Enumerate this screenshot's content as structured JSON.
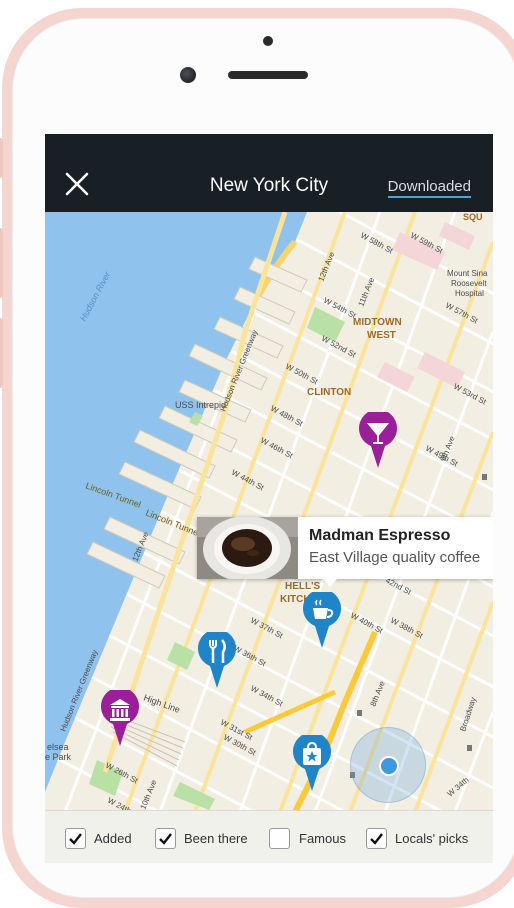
{
  "header": {
    "title": "New York City",
    "downloaded_label": "Downloaded"
  },
  "map": {
    "labels": {
      "hudson_river": "Hudson River",
      "midtown": "MIDTOWN",
      "west": "WEST",
      "clinton": "CLINTON",
      "hells": "HELL'S",
      "kitchen": "KITCH",
      "uss_intrepid": "USS Intrepid",
      "lincoln_tunnel_1": "Lincoln Tunnel",
      "lincoln_tunnel_2": "Lincoln Tunnel",
      "mount_sinai_1": "Mount Sina",
      "mount_sinai_2": "Roosevelt",
      "mount_sinai_3": "Hospital",
      "squ": "SQU",
      "chelsea": "elsea",
      "park": "e Park",
      "high_line": "High Line",
      "hudson_greenway": "Hudson River Greenway",
      "hudson_greenway_2": "Hudson River Greenway",
      "twelfth_ave": "12th Ave",
      "twelfth_ave_2": "12th Ave",
      "eleventh_ave": "11th Ave",
      "tenth_ave": "10th Ave",
      "ninth_ave": "9th Ave",
      "eighth_ave": "8th Ave",
      "broadway": "Broadway",
      "w58": "W 58th St",
      "w54": "W 54th St",
      "w52": "W 52nd St",
      "w50": "W 50th St",
      "w48": "W 48th St",
      "w46": "W 46th St",
      "w44": "W 44th St",
      "w37": "W 37th St",
      "w36": "W 36th St",
      "w34": "W 34th St",
      "w31": "W 31st St",
      "w30": "W 30th St",
      "w26": "W 26th St",
      "w24": "W 24th St",
      "w57": "W 57th St",
      "w53": "W 53rd St",
      "w49": "W 49th St",
      "w42": "42nd St",
      "w40": "W 40th St",
      "w38": "W 38th St",
      "w34b": "W 34th",
      "w59": "W 59th St"
    },
    "pins": [
      {
        "type": "bar",
        "color": "#9c1f9a"
      },
      {
        "type": "cafe",
        "color": "#1f84c8"
      },
      {
        "type": "restaurant",
        "color": "#1f84c8"
      },
      {
        "type": "museum",
        "color": "#9c1f9a"
      },
      {
        "type": "shopping",
        "color": "#1f84c8"
      }
    ]
  },
  "popup": {
    "name": "Madman Espresso",
    "description": "East Village quality coffee"
  },
  "filters": [
    {
      "label": "Added",
      "checked": true
    },
    {
      "label": "Been there",
      "checked": true
    },
    {
      "label": "Famous",
      "checked": false
    },
    {
      "label": "Locals' picks",
      "checked": true
    }
  ],
  "colors": {
    "header_bg": "#182025",
    "water": "#8fc3ee",
    "accent_blue": "#1f84c8",
    "accent_purple": "#9c1f9a",
    "downloaded_underline": "#4aa5d9"
  }
}
